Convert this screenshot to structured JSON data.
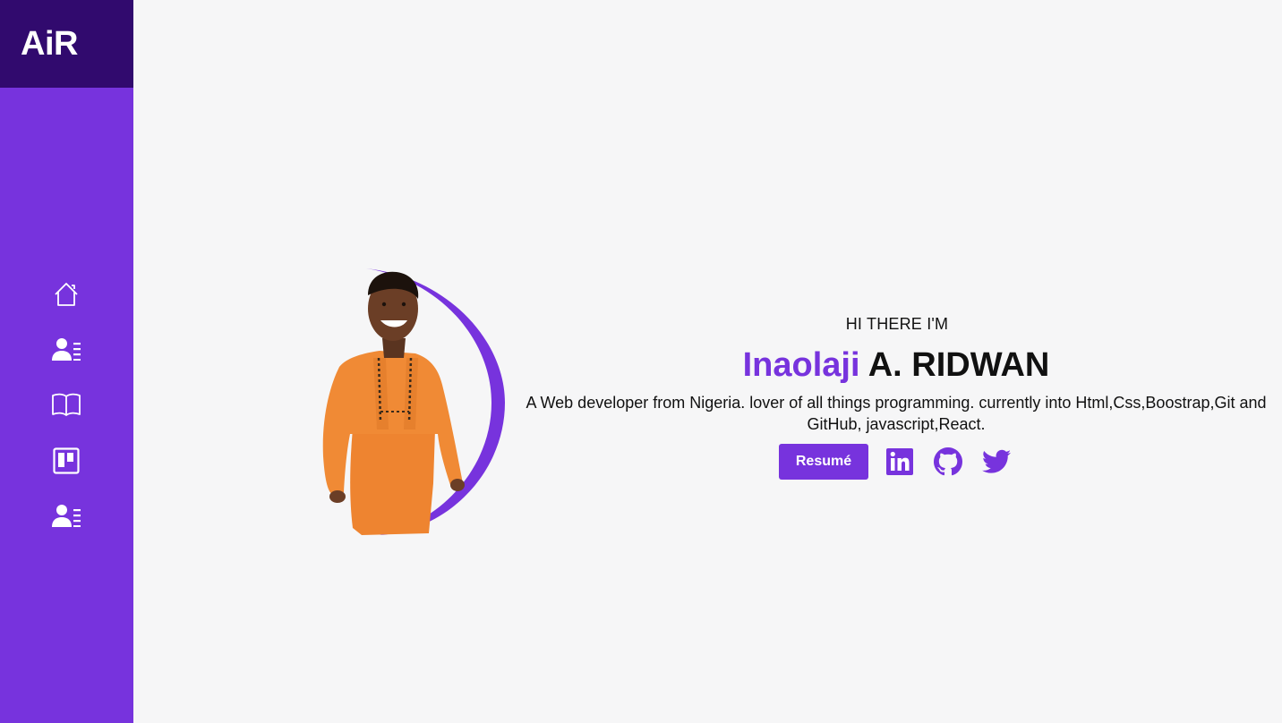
{
  "brand": {
    "logo_text": "AiR"
  },
  "sidebar": {
    "items": [
      {
        "icon": "home-icon"
      },
      {
        "icon": "about-user-icon"
      },
      {
        "icon": "book-icon"
      },
      {
        "icon": "projects-board-icon"
      },
      {
        "icon": "contact-user-icon"
      }
    ]
  },
  "hero": {
    "greeting": "HI THERE I'M",
    "first_name": "Inaolaji",
    "last_name": "A. RIDWAN",
    "bio": "A Web developer from Nigeria. lover of all things programming. currently into Html,Css,Boostrap,Git and GitHub, javascript,React.",
    "resume_label": "Resumé",
    "socials": [
      {
        "icon": "linkedin-icon"
      },
      {
        "icon": "github-icon"
      },
      {
        "icon": "twitter-icon"
      }
    ]
  },
  "colors": {
    "accent": "#7733dd",
    "brand_dark": "#310a6e",
    "background": "#f6f6f7",
    "text": "#111111",
    "shirt": "#f08a35"
  }
}
